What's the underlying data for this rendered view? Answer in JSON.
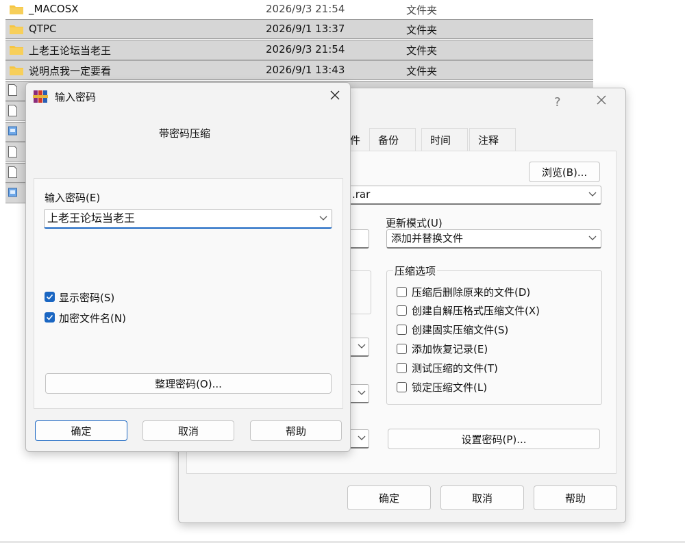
{
  "files": [
    {
      "name": "_MACOSX",
      "date": "2026/9/3 21:54",
      "type": "文件夹",
      "kind": "folder",
      "selected": false
    },
    {
      "name": "QTPC",
      "date": "2026/9/1 13:37",
      "type": "文件夹",
      "kind": "folder",
      "selected": true
    },
    {
      "name": "上老王论坛当老王",
      "date": "2026/9/3 21:54",
      "type": "文件夹",
      "kind": "folder",
      "selected": true
    },
    {
      "name": "说明点我一定要看",
      "date": "2026/9/1 13:43",
      "type": "文件夹",
      "kind": "folder",
      "selected": true
    },
    {
      "name": "",
      "date": "",
      "type": "",
      "kind": "file",
      "selected": true
    },
    {
      "name": "",
      "date": "",
      "type": "",
      "kind": "file",
      "selected": true
    },
    {
      "name": "",
      "date": "",
      "type": "",
      "kind": "file-blue",
      "selected": true
    },
    {
      "name": "",
      "date": "",
      "type": "",
      "kind": "file",
      "selected": true
    },
    {
      "name": "",
      "date": "",
      "type": "",
      "kind": "file",
      "selected": true
    },
    {
      "name": "",
      "date": "",
      "type": "",
      "kind": "file-blue",
      "selected": true
    }
  ],
  "archive_dialog": {
    "help_glyph": "?",
    "tabs": [
      "件",
      "备份",
      "时间",
      "注释"
    ],
    "browse_label": "浏览(B)...",
    "archive_name_suffix": ".rar",
    "update_mode_label": "更新模式(U)",
    "update_mode_value": "添加并替换文件",
    "options_title": "压缩选项",
    "options": [
      {
        "label": "压缩后删除原来的文件(D)",
        "checked": false
      },
      {
        "label": "创建自解压格式压缩文件(X)",
        "checked": false
      },
      {
        "label": "创建固实压缩文件(S)",
        "checked": false
      },
      {
        "label": "添加恢复记录(E)",
        "checked": false
      },
      {
        "label": "测试压缩的文件(T)",
        "checked": false
      },
      {
        "label": "锁定压缩文件(L)",
        "checked": false
      }
    ],
    "set_password_label": "设置密码(P)...",
    "ok_label": "确定",
    "cancel_label": "取消",
    "help_label": "帮助"
  },
  "password_dialog": {
    "title": "输入密码",
    "heading": "带密码压缩",
    "input_label": "输入密码(E)",
    "password_value": "上老王论坛当老王",
    "show_password_label": "显示密码(S)",
    "show_password_checked": true,
    "encrypt_names_label": "加密文件名(N)",
    "encrypt_names_checked": true,
    "organize_label": "整理密码(O)...",
    "ok_label": "确定",
    "cancel_label": "取消",
    "help_label": "帮助"
  },
  "colors": {
    "accent": "#1a66c2",
    "folder": "#f5c542",
    "selection": "#d6d6d6"
  }
}
